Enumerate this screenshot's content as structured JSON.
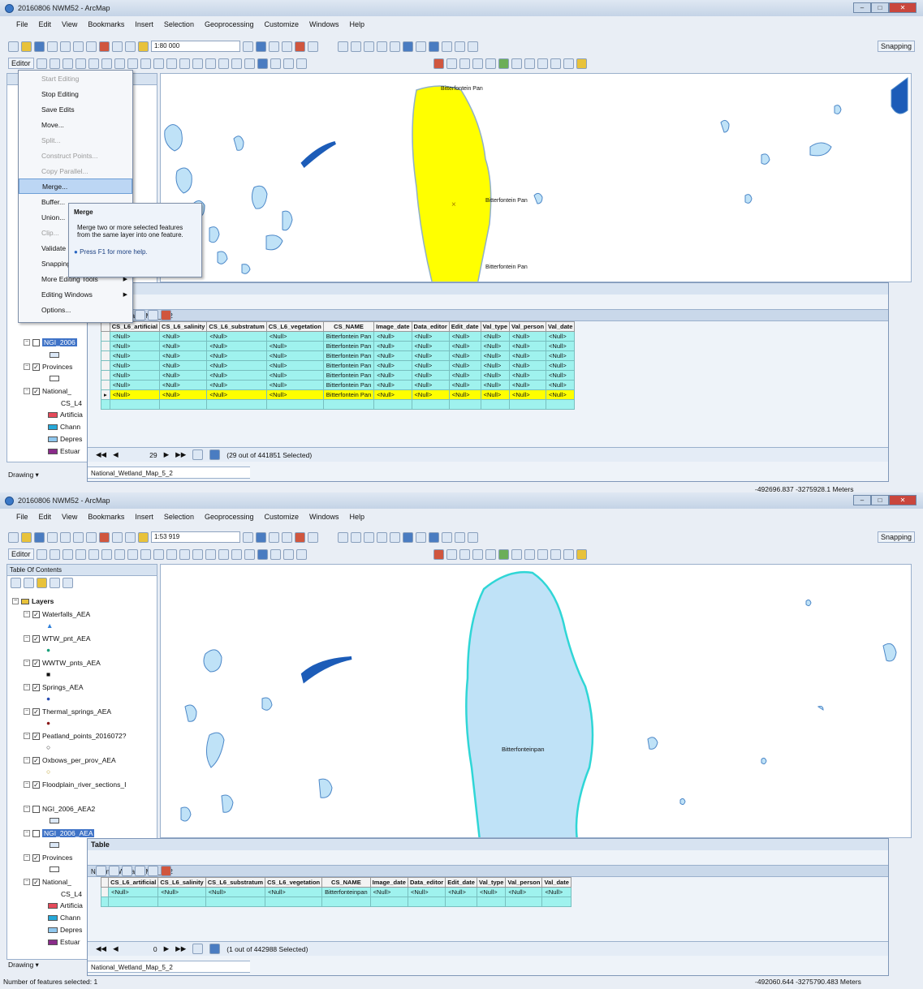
{
  "windows": [
    {
      "title": "20160806 NWM52 - ArcMap",
      "menu": [
        "File",
        "Edit",
        "View",
        "Bookmarks",
        "Insert",
        "Selection",
        "Geoprocessing",
        "Customize",
        "Windows",
        "Help"
      ],
      "scale": "1:80 000",
      "editor_label": "Editor",
      "snapping_label": "Snapping",
      "toc": {
        "title": "",
        "items": [
          "NGI_2006",
          "Provinces",
          "National_",
          "CS_L4",
          "Artificia",
          "Chann",
          "Depres",
          "Estuar"
        ]
      },
      "editor_menu": [
        "Start Editing",
        "Stop Editing",
        "Save Edits",
        "Move...",
        "Split...",
        "Construct Points...",
        "Copy Parallel...",
        "Merge...",
        "Buffer...",
        "Union...",
        "Clip...",
        "Validate",
        "Snapping",
        "More Editing Tools",
        "Editing Windows",
        "Options..."
      ],
      "tooltip": {
        "title": "Merge",
        "body": "Merge two or more selected features from the same layer into one feature.",
        "help": "Press F1 for more help."
      },
      "table": {
        "tab": "National_Wetland_Map_5_2",
        "columns": [
          "CS_L6_artificial",
          "CS_L6_salinity",
          "CS_L6_substratum",
          "CS_L6_vegetation",
          "CS_NAME",
          "Image_date",
          "Data_editor",
          "Edit_date",
          "Val_type",
          "Val_person",
          "Val_date"
        ],
        "rows": [
          [
            "<Null>",
            "<Null>",
            "<Null>",
            "<Null>",
            "Bitterfontein Pan",
            "<Null>",
            "<Null>",
            "<Null>",
            "<Null>",
            "<Null>",
            "<Null>"
          ],
          [
            "<Null>",
            "<Null>",
            "<Null>",
            "<Null>",
            "Bitterfontein Pan",
            "<Null>",
            "<Null>",
            "<Null>",
            "<Null>",
            "<Null>",
            "<Null>"
          ],
          [
            "<Null>",
            "<Null>",
            "<Null>",
            "<Null>",
            "Bitterfontein Pan",
            "<Null>",
            "<Null>",
            "<Null>",
            "<Null>",
            "<Null>",
            "<Null>"
          ],
          [
            "<Null>",
            "<Null>",
            "<Null>",
            "<Null>",
            "Bitterfontein Pan",
            "<Null>",
            "<Null>",
            "<Null>",
            "<Null>",
            "<Null>",
            "<Null>"
          ],
          [
            "<Null>",
            "<Null>",
            "<Null>",
            "<Null>",
            "Bitterfontein Pan",
            "<Null>",
            "<Null>",
            "<Null>",
            "<Null>",
            "<Null>",
            "<Null>"
          ],
          [
            "<Null>",
            "<Null>",
            "<Null>",
            "<Null>",
            "Bitterfontein Pan",
            "<Null>",
            "<Null>",
            "<Null>",
            "<Null>",
            "<Null>",
            "<Null>"
          ],
          [
            "<Null>",
            "<Null>",
            "<Null>",
            "<Null>",
            "Bitterfontein Pan",
            "<Null>",
            "<Null>",
            "<Null>",
            "<Null>",
            "<Null>",
            "<Null>"
          ]
        ],
        "record": "29",
        "selected_text": "(29 out of 441851 Selected)",
        "tab_footer": "National_Wetland_Map_5_2"
      },
      "map_labels": [
        "Bitterfontein Pan",
        "Bitterfontein Pan",
        "Bitterfontein Pan"
      ],
      "drawing_label": "Drawing",
      "coords": "-492696.837  -3275928.1 Meters"
    },
    {
      "title": "20160806 NWM52 - ArcMap",
      "menu": [
        "File",
        "Edit",
        "View",
        "Bookmarks",
        "Insert",
        "Selection",
        "Geoprocessing",
        "Customize",
        "Windows",
        "Help"
      ],
      "scale": "1:53 919",
      "editor_label": "Editor",
      "snapping_label": "Snapping",
      "toc": {
        "title": "Table Of Contents",
        "layers_label": "Layers",
        "items": [
          "Waterfalls_AEA",
          "WTW_pnt_AEA",
          "WWTW_pnts_AEA",
          "Springs_AEA",
          "Thermal_springs_AEA",
          "Peatland_points_2016072?",
          "Oxbows_per_prov_AEA",
          "Floodplain_river_sections_I",
          "NGI_2006_AEA2",
          "NGI_2006_AEA",
          "Provinces",
          "National_",
          "CS_L4",
          "Artificia",
          "Chann",
          "Depres",
          "Estuar"
        ]
      },
      "table": {
        "title": "Table",
        "tab": "National_Wetland_Map_5_2",
        "columns": [
          "CS_L6_artificial",
          "CS_L6_salinity",
          "CS_L6_substratum",
          "CS_L6_vegetation",
          "CS_NAME",
          "Image_date",
          "Data_editor",
          "Edit_date",
          "Val_type",
          "Val_person",
          "Val_date"
        ],
        "rows": [
          [
            "<Null>",
            "<Null>",
            "<Null>",
            "<Null>",
            "Bitterfonteinpan",
            "<Null>",
            "<Null>",
            "<Null>",
            "<Null>",
            "<Null>",
            "<Null>"
          ]
        ],
        "record": "0",
        "selected_text": "(1 out of 442988 Selected)",
        "tab_footer": "National_Wetland_Map_5_2"
      },
      "map_label": "Bitterfonteinpan",
      "drawing_label": "Drawing",
      "status": "Number of features selected: 1",
      "coords": "-492060.644  -3275790.483 Meters"
    }
  ],
  "colors": {
    "water": "#bfe2f7",
    "water_edge": "#4d88c8",
    "yellow": "#ffff00",
    "teal": "#9ff2ee",
    "selected_outline": "#2fd6d6"
  }
}
